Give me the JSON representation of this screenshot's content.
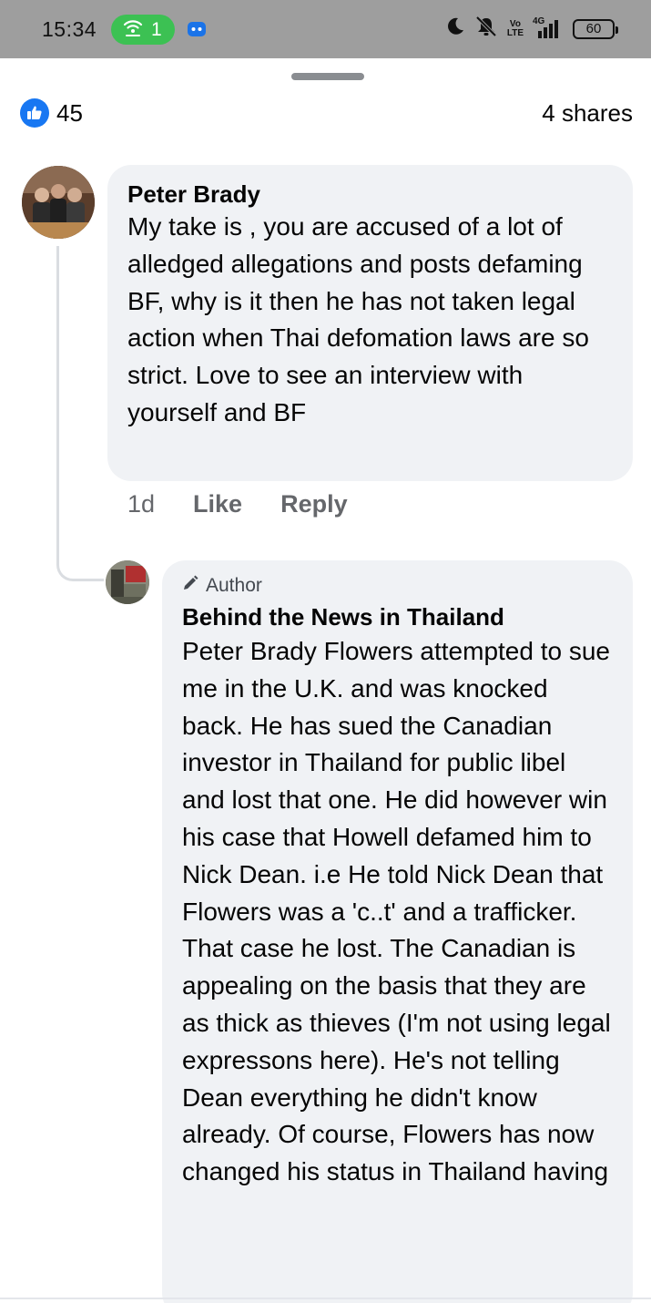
{
  "status_bar": {
    "time": "15:34",
    "hotspot_count": "1",
    "battery": "60",
    "icons": [
      "wifi-hotspot-icon",
      "game-controller-icon",
      "moon-icon",
      "mute-bell-icon",
      "volte-icon",
      "signal-4g-icon",
      "battery-icon"
    ],
    "volte_line1": "Vo",
    "volte_line2": "LTE",
    "network": "4G"
  },
  "post_stats": {
    "likes": "45",
    "shares": "4 shares",
    "accent": "#1877f2"
  },
  "comments": [
    {
      "author": "Peter Brady",
      "text": "My take is , you are accused of a lot of alledged allegations and posts defaming BF, why is it then he has not taken legal action when Thai defomation laws are so strict. Love to see an interview with yourself and BF",
      "time": "1d",
      "like_label": "Like",
      "reply_label": "Reply"
    },
    {
      "badge": "Author",
      "author": "Behind the News in Thailand",
      "text": "Peter Brady Flowers attempted to sue me in the U.K. and was knocked back. He has sued the Canadian investor in Thailand for public libel and lost that one. He did however win his case that Howell defamed him to Nick Dean.  i.e He told Nick Dean that Flowers was a  'c..t' and a trafficker. That case he lost. The Canadian is appealing  on the basis that they are as thick as thieves (I'm not using legal expressons here). He's not telling Dean everything he didn't know already. Of course, Flowers has now changed his status in Thailand having"
    }
  ]
}
